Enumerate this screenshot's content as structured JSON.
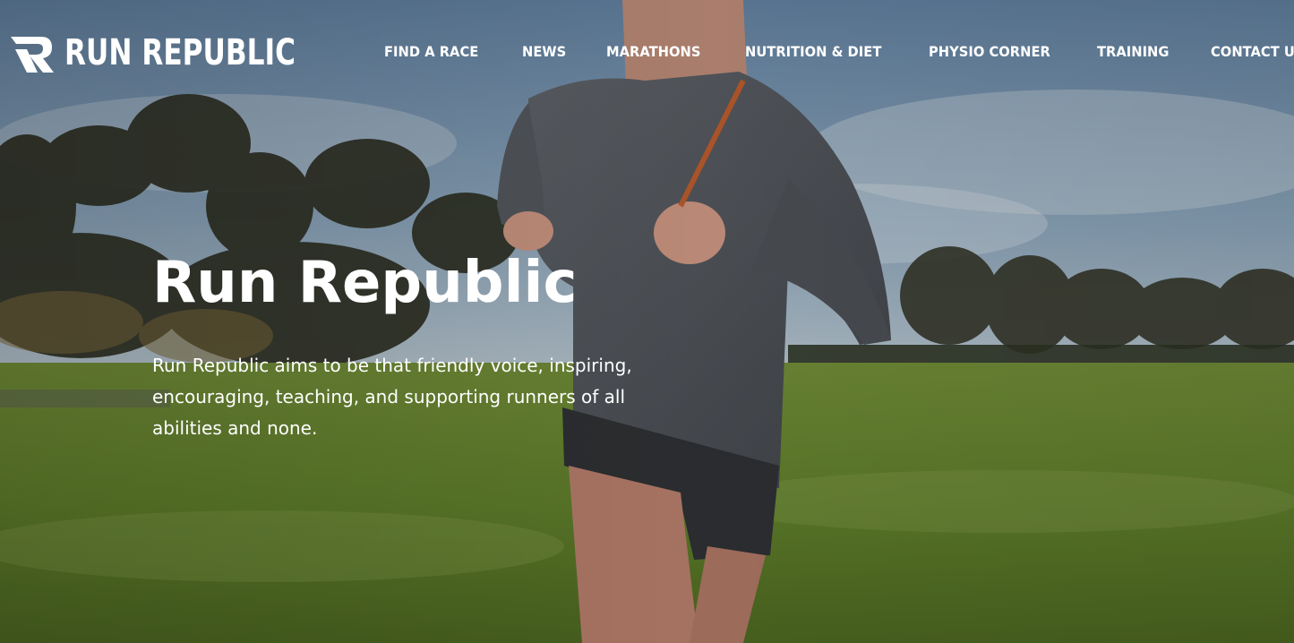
{
  "brand": {
    "name": "RUN REPUBLIC"
  },
  "nav": {
    "items": [
      {
        "label": "FIND A RACE"
      },
      {
        "label": "NEWS"
      },
      {
        "label": "MARATHONS"
      },
      {
        "label": "NUTRITION & DIET"
      },
      {
        "label": "PHYSIO CORNER"
      },
      {
        "label": "TRAINING"
      },
      {
        "label": "CONTACT US"
      }
    ]
  },
  "hero": {
    "title": "Run Republic",
    "description": "Run Republic aims to be that friendly voice, inspiring, encouraging, teaching, and supporting runners of all abilities and none."
  },
  "colors": {
    "text": "#ffffff",
    "sky": "#6f8aa3",
    "grass": "#5e7a28",
    "shirt": "#4e5257"
  },
  "icons": {
    "logo_mark": "run-republic-r-icon"
  }
}
